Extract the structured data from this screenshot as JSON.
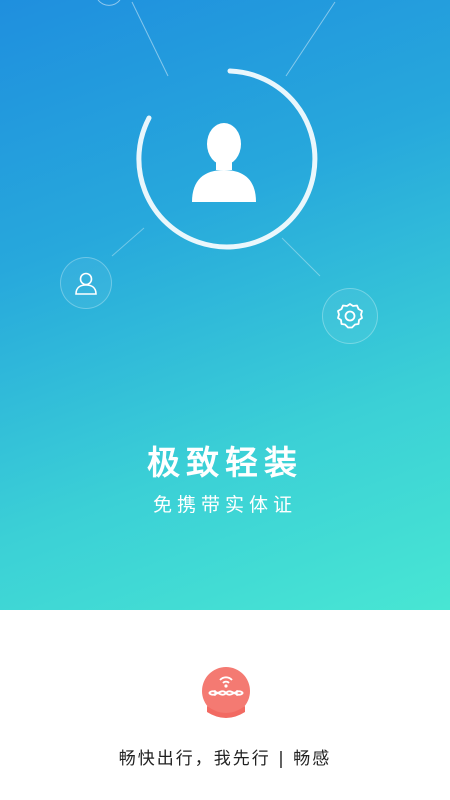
{
  "hero": {
    "headline": "极致轻装",
    "subline": "免携带实体证"
  },
  "footer": {
    "slogan": "畅快出行，我先行 | 畅感"
  },
  "icons": {
    "avatar": "user-avatar-icon",
    "user": "user-icon",
    "settings": "gear-icon",
    "logo": "app-logo-icon"
  },
  "colors": {
    "gradient_start": "#1f8fde",
    "gradient_end": "#48e6d3",
    "logo": "#f47a72"
  }
}
